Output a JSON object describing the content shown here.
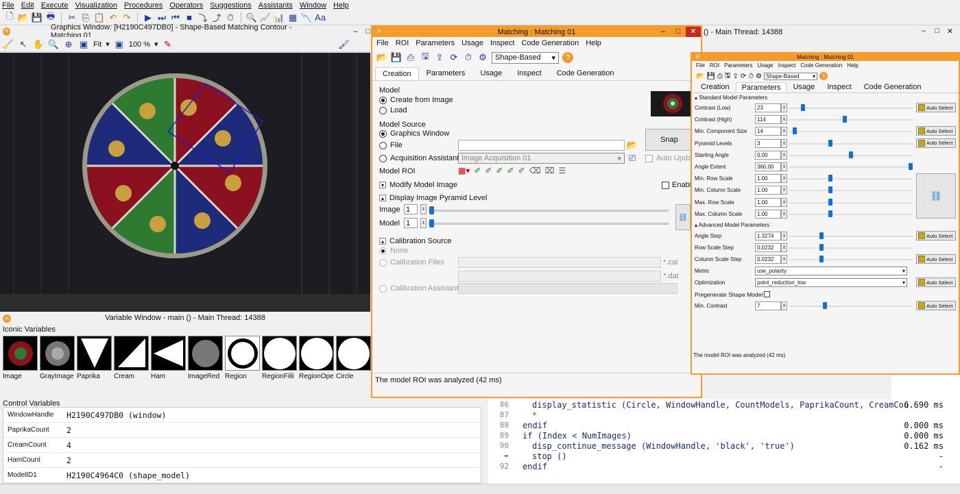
{
  "menu": [
    "File",
    "Edit",
    "Execute",
    "Visualization",
    "Procedures",
    "Operators",
    "Suggestions",
    "Assistants",
    "Window",
    "Help"
  ],
  "graphics": {
    "title": "Graphics Window: [H2190C497DB0] - Shape-Based Matching Contour - Matching 01",
    "fit": "Fit",
    "zoom": "100 %"
  },
  "variables": {
    "title": "Variable Window - main () - Main Thread: 14388",
    "iconic_label": "Iconic Variables",
    "control_label": "Control Variables",
    "iconic": [
      "Image",
      "GrayImage",
      "Paprika",
      "Cream",
      "Ham",
      "ImageRed",
      "Region",
      "RegionFilli",
      "RegionOpe",
      "Circle"
    ],
    "control": [
      {
        "name": "WindowHandle",
        "value": "H2190C497DB0 (window)"
      },
      {
        "name": "PaprikaCount",
        "value": "2"
      },
      {
        "name": "CreamCount",
        "value": "4"
      },
      {
        "name": "HamCount",
        "value": "2"
      },
      {
        "name": "ModelID1",
        "value": "H2190C4964C0 (shape_model)"
      }
    ]
  },
  "code": {
    "lines": [
      {
        "n": "86",
        "text": "display_statistic (Circle, WindowHandle, CountModels, PaprikaCount, CreamCou",
        "ms": "6.690 ms"
      },
      {
        "n": "87",
        "text": "*",
        "ms": ""
      },
      {
        "n": "88",
        "text": "endif",
        "ms": "0.000 ms"
      },
      {
        "n": "89",
        "text": "if (Index < NumImages)",
        "ms": "0.000 ms"
      },
      {
        "n": "90",
        "text": "disp_continue_message (WindowHandle, 'black', 'true')",
        "ms": "0.162 ms"
      },
      {
        "n": "",
        "text": "stop ()",
        "ms": "-"
      },
      {
        "n": "92",
        "text": "endif",
        "ms": "-"
      }
    ]
  },
  "bg_window": {
    "title": "() - Main Thread: 14388"
  },
  "matching1": {
    "title": "Matching : Matching 01",
    "menu": [
      "File",
      "ROI",
      "Parameters",
      "Usage",
      "Inspect",
      "Code Generation",
      "Help"
    ],
    "method": "Shape-Based",
    "tabs": [
      "Creation",
      "Parameters",
      "Usage",
      "Inspect",
      "Code Generation"
    ],
    "model_label": "Model",
    "create_from_image": "Create from Image",
    "load": "Load",
    "model_source": "Model Source",
    "graphics_window": "Graphics Window",
    "file": "File",
    "acq_assistant": "Acquisition Assistant",
    "acq_value": "Image Acquisition 01",
    "snap": "Snap",
    "auto_update": "Auto Update",
    "model_roi": "Model ROI",
    "modify_model_image": "Modify Model Image",
    "enable": "Enable",
    "display_pyramid": "Display Image Pyramid Level",
    "image": "Image",
    "model": "Model",
    "image_val": "1",
    "model_val": "1",
    "calibration_source": "Calibration Source",
    "none": "None",
    "calibration_files": "Calibration Files",
    "cal_ext": "*.cal",
    "dat_ext": "*.dat",
    "calibration_assistant": "Calibration Assistant",
    "status": "The model ROI was analyzed (42 ms)"
  },
  "matching2": {
    "title": "Matching : Matching 01",
    "menu": [
      "File",
      "ROI",
      "Parameters",
      "Usage",
      "Inspect",
      "Code Generation",
      "Help"
    ],
    "method": "Shape-Based",
    "tabs": [
      "Creation",
      "Parameters",
      "Usage",
      "Inspect",
      "Code Generation"
    ],
    "standard": "Standard Model Parameters",
    "advanced": "Advanced Model Parameters",
    "params": [
      {
        "name": "Contrast (Low)",
        "value": "23",
        "pos": 0.1
      },
      {
        "name": "Contrast (High)",
        "value": "114",
        "pos": 0.45
      },
      {
        "name": "Min. Component Size",
        "value": "14",
        "pos": 0.03
      },
      {
        "name": "Pyramid Levels",
        "value": "3",
        "pos": 0.33
      },
      {
        "name": "Starting Angle",
        "value": "0.00",
        "pos": 0.5
      },
      {
        "name": "Angle Extent",
        "value": "360.00",
        "pos": 1.0
      },
      {
        "name": "Min. Row Scale",
        "value": "1.00",
        "pos": 0.33
      },
      {
        "name": "Min. Column Scale",
        "value": "1.00",
        "pos": 0.33
      },
      {
        "name": "Max. Row Scale",
        "value": "1.00",
        "pos": 0.33
      },
      {
        "name": "Max. Column Scale",
        "value": "1.00",
        "pos": 0.33
      }
    ],
    "adv_params": [
      {
        "name": "Angle Step",
        "value": "1.3274",
        "pos": 0.25
      },
      {
        "name": "Row Scale Step",
        "value": "0.0232",
        "pos": 0.25
      },
      {
        "name": "Column Scale Step",
        "value": "0.0232",
        "pos": 0.25
      }
    ],
    "metric_label": "Metric",
    "metric": "use_polarity",
    "optimization_label": "Optimization",
    "optimization": "point_reduction_low",
    "pregenerate": "Pregenerate Shape Model",
    "min_contrast_label": "Min. Contrast",
    "min_contrast": "7",
    "min_contrast_pos": 0.28,
    "auto_select": "Auto Select",
    "status": "The model ROI was analyzed (42 ms)"
  }
}
